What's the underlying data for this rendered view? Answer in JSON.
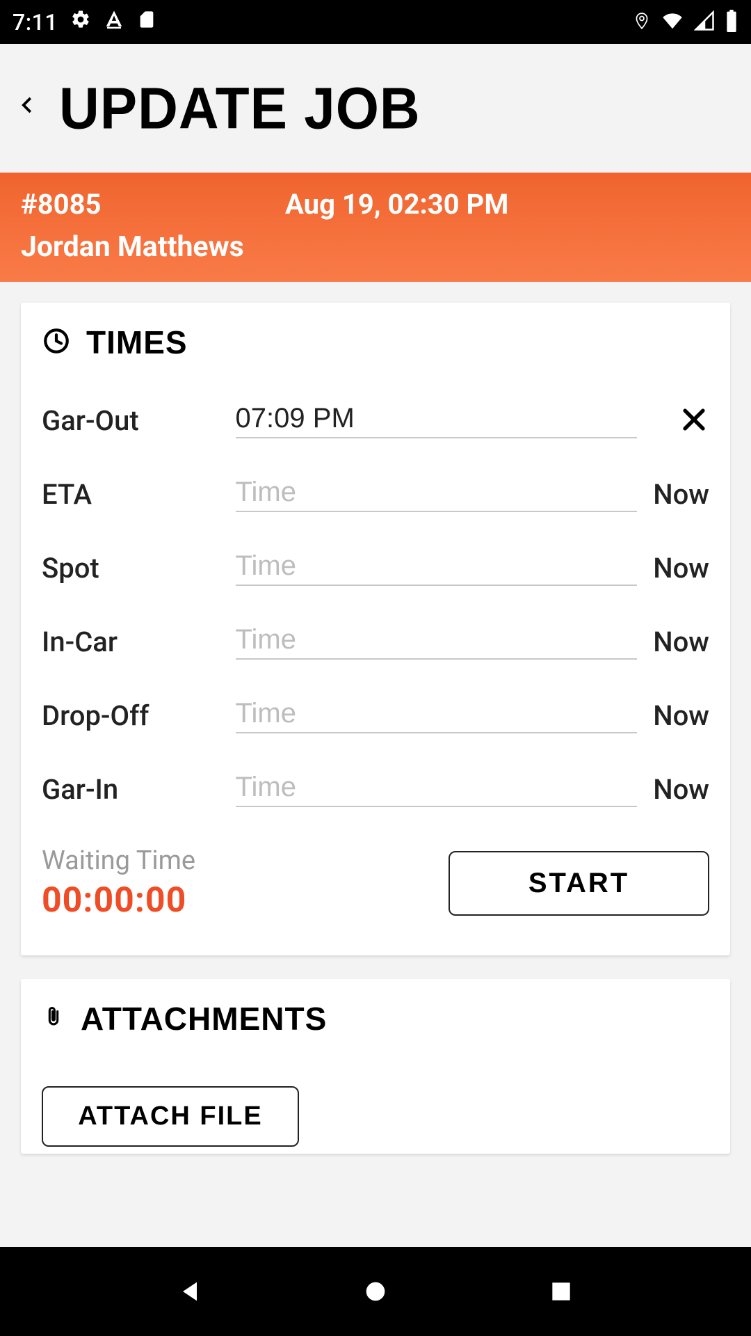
{
  "status": {
    "time": "7:11",
    "icons_left": [
      "gear-icon",
      "font-a-icon",
      "sd-card-icon"
    ],
    "icons_right": [
      "location-pin-icon",
      "wifi-icon",
      "cell-signal-icon",
      "battery-icon"
    ]
  },
  "header": {
    "title": "UPDATE JOB"
  },
  "job": {
    "id": "#8085",
    "datetime": "Aug 19, 02:30 PM",
    "customer": "Jordan Matthews"
  },
  "times_card": {
    "title": "TIMES",
    "rows": [
      {
        "label": "Gar-Out",
        "value": "07:09 PM",
        "action": "clear",
        "action_label": ""
      },
      {
        "label": "ETA",
        "value": "",
        "action": "now",
        "action_label": "Now"
      },
      {
        "label": "Spot",
        "value": "",
        "action": "now",
        "action_label": "Now"
      },
      {
        "label": "In-Car",
        "value": "",
        "action": "now",
        "action_label": "Now"
      },
      {
        "label": "Drop-Off",
        "value": "",
        "action": "now",
        "action_label": "Now"
      },
      {
        "label": "Gar-In",
        "value": "",
        "action": "now",
        "action_label": "Now"
      }
    ],
    "time_placeholder": "Time",
    "waiting": {
      "label": "Waiting Time",
      "value": "00:00:00",
      "start_label": "START"
    }
  },
  "attachments_card": {
    "title": "ATTACHMENTS",
    "attach_label": "ATTACH FILE"
  },
  "colors": {
    "accent_orange_top": "#f0642e",
    "accent_orange_bottom": "#f97b48",
    "waiting_value": "#ee4d25"
  }
}
